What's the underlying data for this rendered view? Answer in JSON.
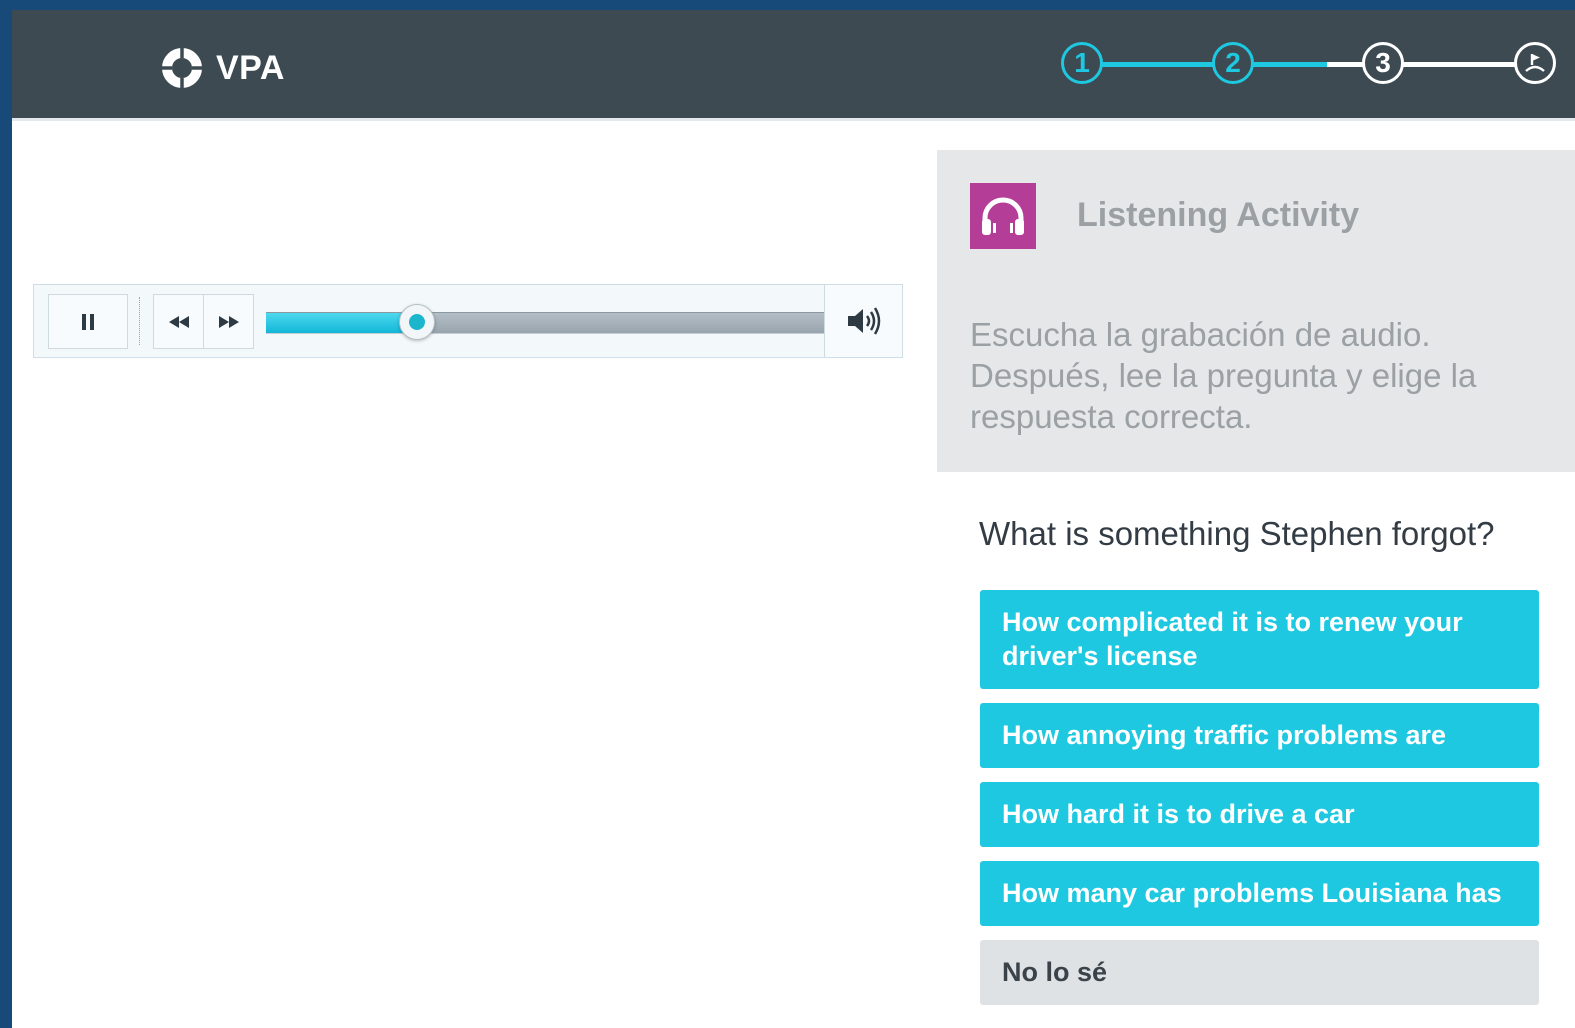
{
  "header": {
    "app_name": "VPA",
    "steps": [
      {
        "label": "1",
        "state": "complete"
      },
      {
        "label": "2",
        "state": "complete"
      },
      {
        "label": "3",
        "state": "upcoming"
      },
      {
        "label": "finish",
        "state": "upcoming",
        "icon": "finish-flag-icon"
      }
    ]
  },
  "player": {
    "pause_icon": "pause-icon",
    "rewind_icon": "rewind-icon",
    "forward_icon": "fast-forward-icon",
    "volume_icon": "volume-icon",
    "progress": 0.27
  },
  "activity": {
    "title": "Listening Activity",
    "icon": "headphones-icon",
    "instructions": "Escucha la grabación de audio. Después, lee la pregunta y elige la respuesta correcta."
  },
  "question": {
    "text": "What is something Stephen forgot?",
    "answers": [
      {
        "label": "How complicated it is to renew your driver's license"
      },
      {
        "label": "How annoying traffic problems are"
      },
      {
        "label": "How hard it is to drive a car"
      },
      {
        "label": "How many car problems Louisiana has"
      }
    ],
    "dont_know_label": "No lo sé"
  },
  "colors": {
    "accent": "#1ec8e0",
    "header_bg": "#3d4a52",
    "outer_frame": "#174a78",
    "activity_icon_bg": "#b43d97",
    "panel_bg": "#e6e7e8"
  }
}
